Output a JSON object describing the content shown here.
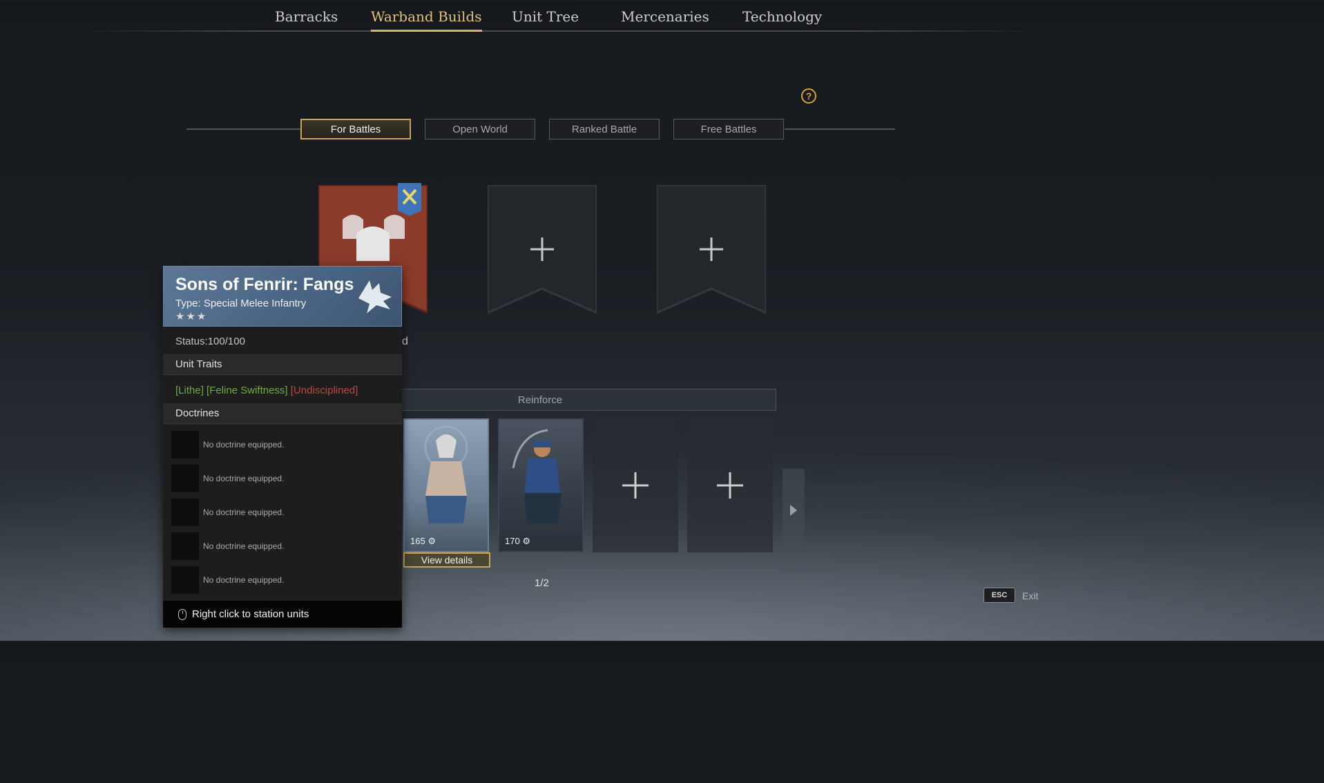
{
  "nav": {
    "items": [
      {
        "label": "Barracks"
      },
      {
        "label": "Warband Builds",
        "active": true
      },
      {
        "label": "Unit Tree"
      },
      {
        "label": "Mercenaries"
      },
      {
        "label": "Technology"
      }
    ]
  },
  "help": {
    "symbol": "?"
  },
  "modes": {
    "tabs": [
      {
        "label": "For Battles",
        "active": true
      },
      {
        "label": "Open World"
      },
      {
        "label": "Ranked Battle"
      },
      {
        "label": "Free Battles"
      }
    ]
  },
  "warband": {
    "banners": [
      {
        "state": "filled",
        "color": "#8a3b2a",
        "icon": "knight-helmets-icon",
        "badge_icon": "crossed-swords-icon"
      },
      {
        "state": "empty",
        "icon": "plus-icon"
      },
      {
        "state": "empty",
        "icon": "plus-icon"
      }
    ],
    "partial_text": "d"
  },
  "reinforce": {
    "label": "Reinforce"
  },
  "units": {
    "cards": [
      {
        "cost": "165",
        "icon": "gear-icon",
        "portrait": "wolf-pelt-warrior"
      },
      {
        "cost": "170",
        "icon": "gear-icon",
        "portrait": "scimitar-warrior"
      },
      {
        "state": "empty",
        "icon": "plus-icon"
      },
      {
        "state": "empty",
        "icon": "plus-icon"
      }
    ],
    "view_details_label": "View details",
    "pager": "1/2"
  },
  "exit": {
    "key": "ESC",
    "label": "Exit"
  },
  "tooltip": {
    "title": "Sons of Fenrir: Fangs",
    "type": "Type: Special Melee Infantry",
    "stars": "★★★",
    "emblem": "wolf-head-icon",
    "status": "Status:100/100",
    "traits_header": "Unit Traits",
    "traits": [
      {
        "text": "[Lithe]",
        "color": "#6fae3e"
      },
      {
        "text": "[Feline Swiftness]",
        "color": "#6fae3e"
      },
      {
        "text": "[Undisciplined]",
        "color": "#c0473a"
      }
    ],
    "doctrines_header": "Doctrines",
    "doctrines": [
      {
        "text": "No doctrine equipped."
      },
      {
        "text": "No doctrine equipped."
      },
      {
        "text": "No doctrine equipped."
      },
      {
        "text": "No doctrine equipped."
      },
      {
        "text": "No doctrine equipped."
      }
    ],
    "footer": "Right click to station units",
    "footer_icon": "mouse-icon"
  },
  "colors": {
    "accent_gold": "#d9b55f",
    "tooltip_header": "#4a6584",
    "trait_positive": "#6fae3e",
    "trait_negative": "#c0473a"
  }
}
